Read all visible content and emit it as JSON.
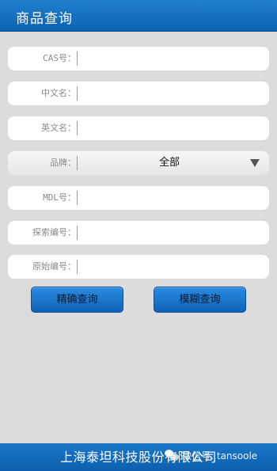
{
  "header": {
    "title": "商品查询"
  },
  "form": {
    "cas": {
      "label": "CAS号：",
      "value": ""
    },
    "cn_name": {
      "label": "中文名：",
      "value": ""
    },
    "en_name": {
      "label": "英文名：",
      "value": ""
    },
    "brand": {
      "label": "品牌：",
      "selected": "全部"
    },
    "mdl": {
      "label": "MDL号：",
      "value": ""
    },
    "search_no": {
      "label": "探索编号：",
      "value": ""
    },
    "origin_no": {
      "label": "原始编号：",
      "value": ""
    }
  },
  "buttons": {
    "exact": "精确查询",
    "fuzzy": "模糊查询"
  },
  "footer": {
    "company": "上海泰坦科技股份有限公司"
  },
  "watermark": {
    "text": "微信号: tansoole"
  },
  "colors": {
    "title_bar": "#1170c2",
    "background": "#dcdcdc",
    "button_blue": "#1a74c9"
  },
  "icons": {
    "select_arrow": "triangle-down-icon",
    "watermark": "wechat-icon"
  }
}
